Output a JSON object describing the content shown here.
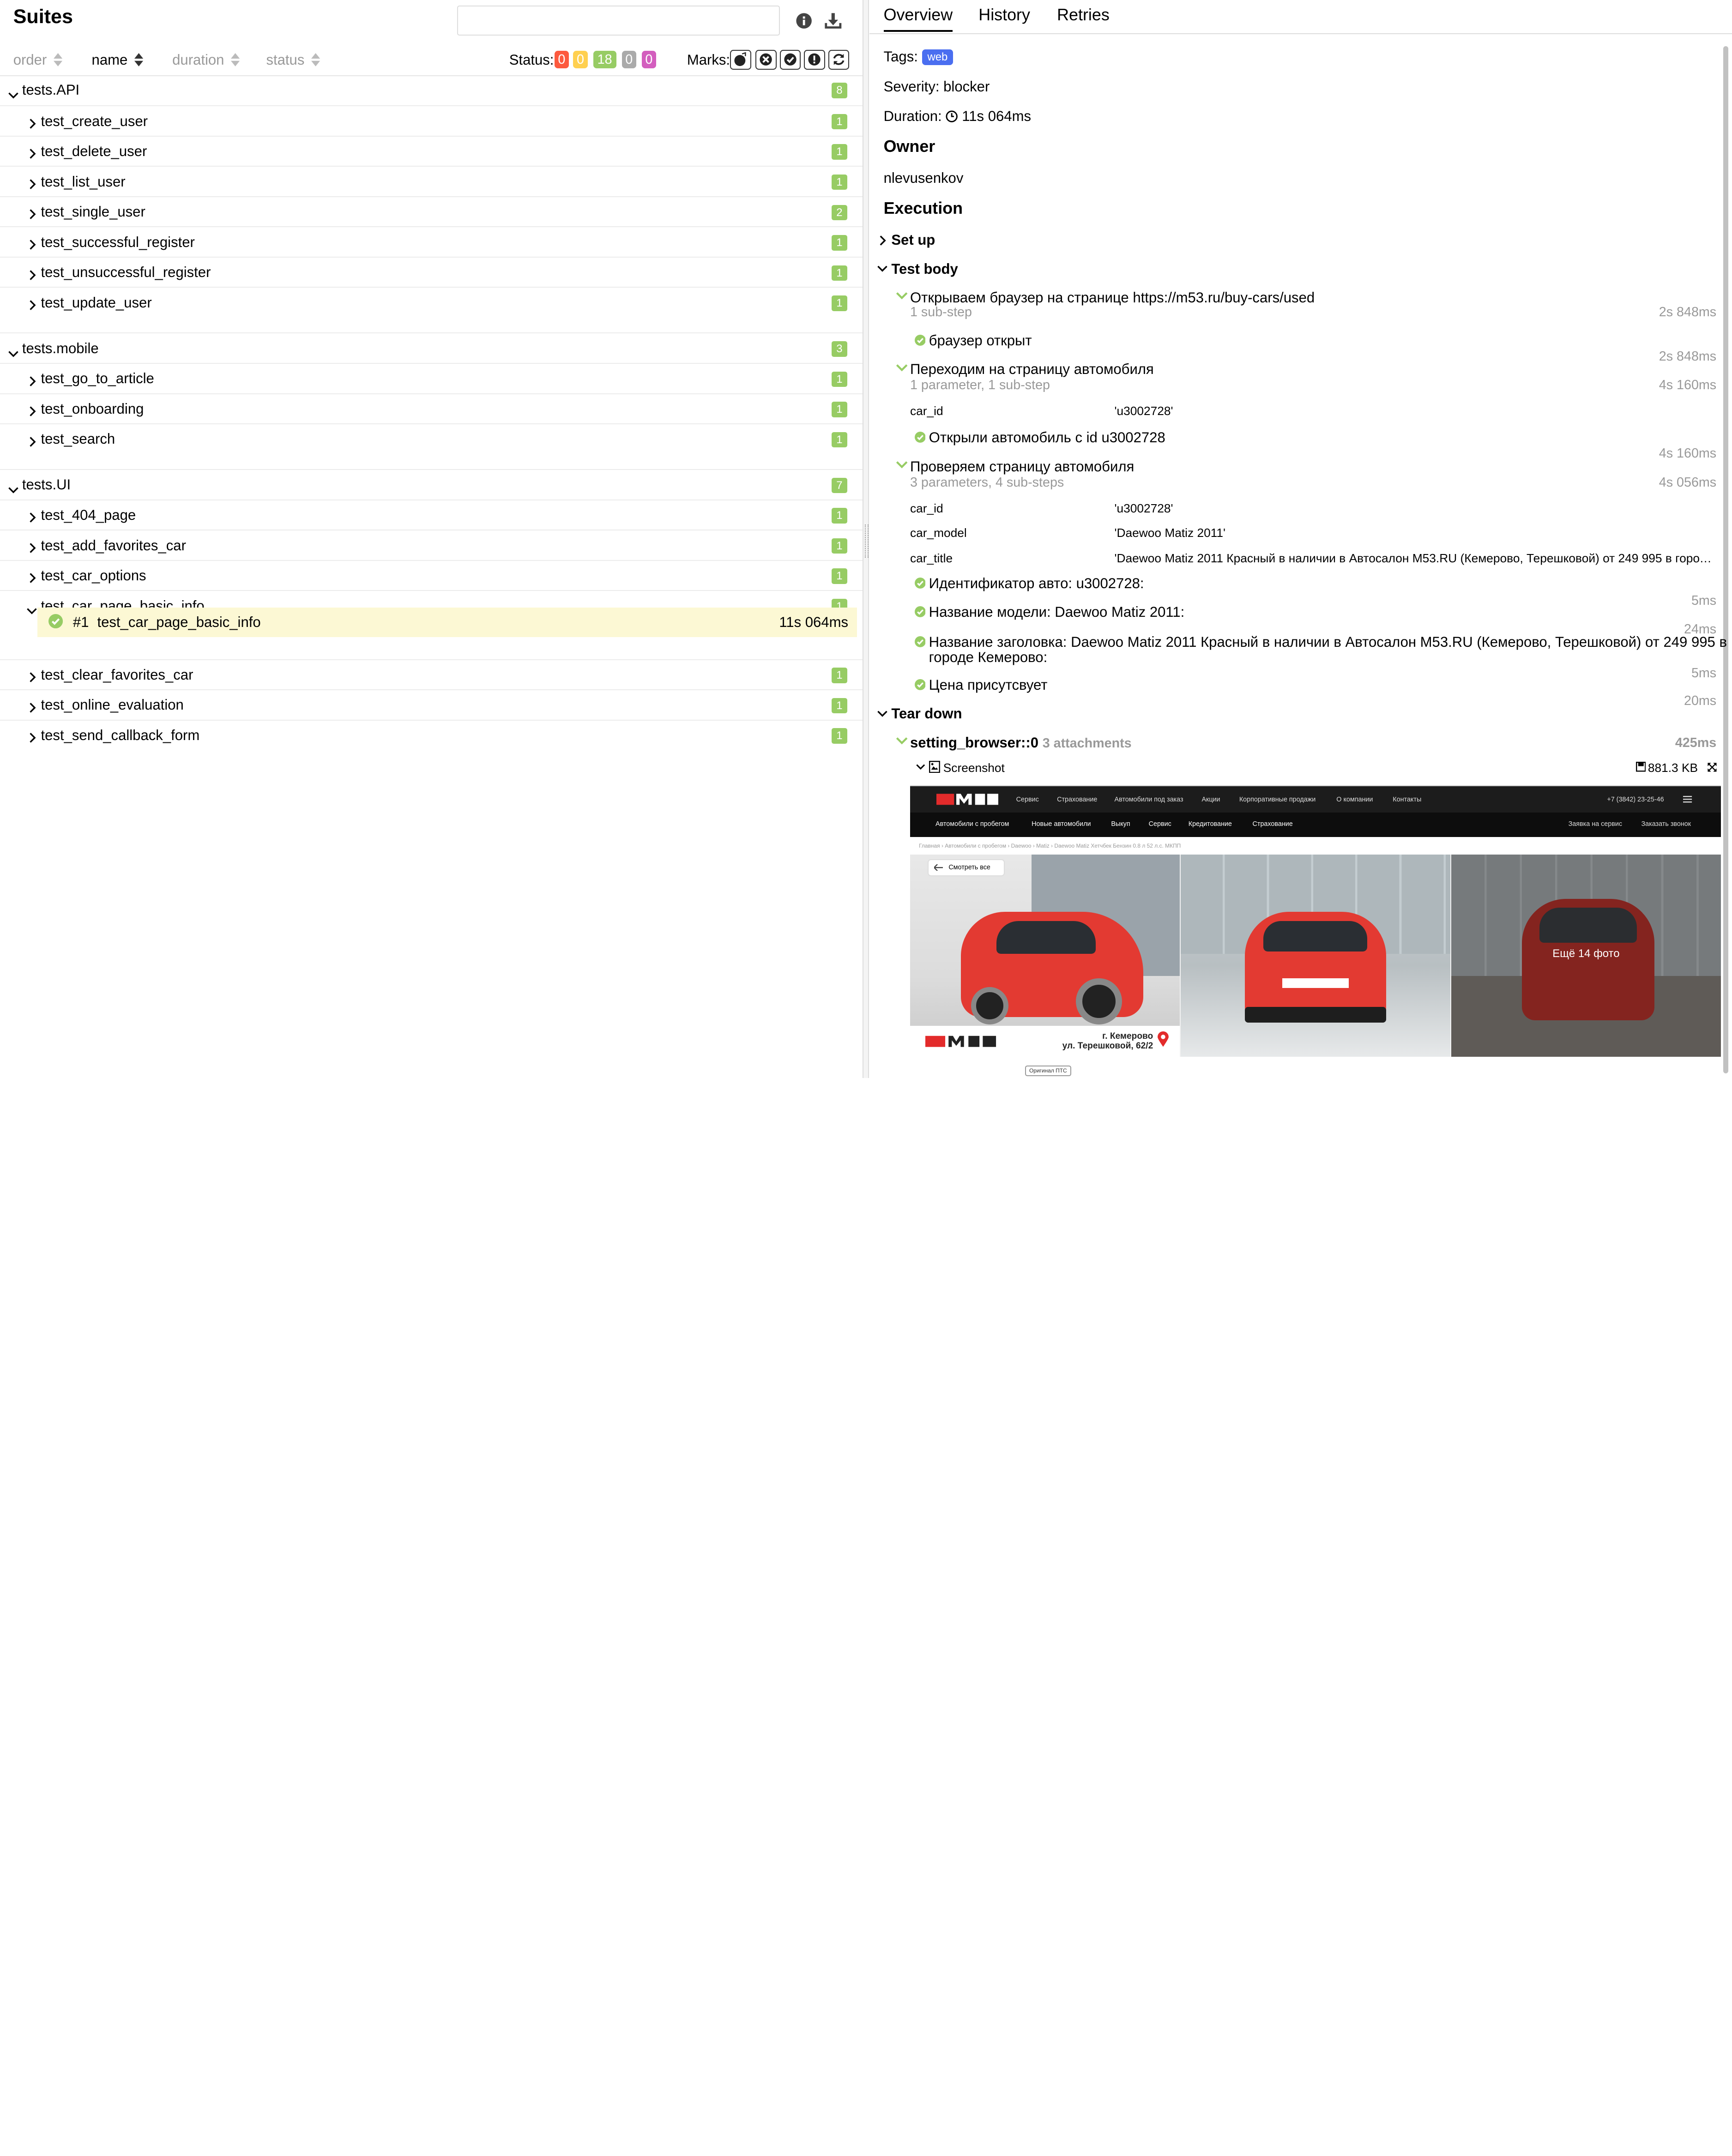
{
  "left": {
    "title": "Suites",
    "search_value": "",
    "sort": {
      "order": "order",
      "name": "name",
      "duration": "duration",
      "status": "status"
    },
    "status_label": "Status:",
    "status_counts": [
      {
        "value": "0",
        "color": "#fd5a3e"
      },
      {
        "value": "0",
        "color": "#ffd050"
      },
      {
        "value": "18",
        "color": "#97cc64"
      },
      {
        "value": "0",
        "color": "#aaaaaa"
      },
      {
        "value": "0",
        "color": "#d35ebe"
      }
    ],
    "marks_label": "Marks:",
    "groups": [
      {
        "name": "tests.API",
        "count": "8",
        "items": [
          {
            "name": "test_create_user",
            "count": "1"
          },
          {
            "name": "test_delete_user",
            "count": "1"
          },
          {
            "name": "test_list_user",
            "count": "1"
          },
          {
            "name": "test_single_user",
            "count": "2"
          },
          {
            "name": "test_successful_register",
            "count": "1"
          },
          {
            "name": "test_unsuccessful_register",
            "count": "1"
          },
          {
            "name": "test_update_user",
            "count": "1"
          }
        ]
      },
      {
        "name": "tests.mobile",
        "count": "3",
        "items": [
          {
            "name": "test_go_to_article",
            "count": "1"
          },
          {
            "name": "test_onboarding",
            "count": "1"
          },
          {
            "name": "test_search",
            "count": "1"
          }
        ]
      },
      {
        "name": "tests.UI",
        "count": "7",
        "items": [
          {
            "name": "test_404_page",
            "count": "1"
          },
          {
            "name": "test_add_favorites_car",
            "count": "1"
          },
          {
            "name": "test_car_options",
            "count": "1"
          },
          {
            "name": "test_car_page_basic_info",
            "count": "1"
          },
          {
            "name": "test_clear_favorites_car",
            "count": "1"
          },
          {
            "name": "test_online_evaluation",
            "count": "1"
          },
          {
            "name": "test_send_callback_form",
            "count": "1"
          }
        ]
      }
    ],
    "selected": {
      "num": "#1",
      "name": "test_car_page_basic_info",
      "duration": "11s 064ms"
    }
  },
  "right": {
    "tabs": [
      "Overview",
      "History",
      "Retries"
    ],
    "tags_label": "Tags:",
    "tag": "web",
    "severity": "Severity: blocker",
    "duration_label": "Duration:",
    "duration_value": "11s 064ms",
    "owner_heading": "Owner",
    "owner": "nlevusenkov",
    "execution_heading": "Execution",
    "setup": "Set up",
    "test_body": "Test body",
    "steps": [
      {
        "title": "Открываем браузер на странице https://m53.ru/buy-cars/used",
        "meta": "1 sub-step",
        "duration": "2s 848ms"
      },
      {
        "title": "Переходим на страницу автомобиля",
        "meta": "1 parameter, 1 sub-step",
        "duration": "4s 160ms"
      },
      {
        "title": "Проверяем страницу автомобиля",
        "meta": "3 parameters, 4 sub-steps",
        "duration": "4s 056ms"
      }
    ],
    "sub1": {
      "text": "браузер открыт",
      "duration": "2s 848ms"
    },
    "sub2": {
      "param_k": "car_id",
      "param_v": "'u3002728'",
      "text": "Открыли автомобиль с id u3002728",
      "duration": "4s 160ms"
    },
    "sub3": {
      "params": [
        {
          "k": "car_id",
          "v": "'u3002728'"
        },
        {
          "k": "car_model",
          "v": "'Daewoo Matiz 2011'"
        },
        {
          "k": "car_title",
          "v": "'Daewoo Matiz 2011 Красный в наличии в Автосалон M53.RU (Кемерово, Терешковой) от 249 995 в городе Кемер..."
        }
      ],
      "checks": [
        {
          "text": "Идентификатор авто: u3002728:",
          "duration": "5ms"
        },
        {
          "text": "Название модели: Daewoo Matiz 2011:",
          "duration": "24ms"
        },
        {
          "text": "Название заголовка: Daewoo Matiz 2011 Красный в наличии в Автосалон M53.RU (Кемерово, Терешковой) от 249 995 в",
          "text2": "городе Кемерово:",
          "duration": "5ms"
        },
        {
          "text": "Цена присутсвует",
          "duration": "20ms"
        }
      ]
    },
    "teardown": "Tear down",
    "fixture": {
      "name": "setting_browser::0",
      "meta": "3 attachments",
      "duration": "425ms"
    },
    "attachment": {
      "name": "Screenshot",
      "size": "881.3 KB"
    },
    "screenshot": {
      "nav1": [
        "Сервис",
        "Страхование",
        "Автомобили под заказ",
        "Акции",
        "Корпоративные продажи",
        "О компании",
        "Контакты"
      ],
      "phone": "+7 (3842) 23-25-46",
      "nav2": [
        "Автомобили с пробегом",
        "Новые автомобили",
        "Выкуп",
        "Сервис",
        "Кредитование",
        "Страхование"
      ],
      "nav2_right": [
        "Заявка на сервис",
        "Заказать звонок"
      ],
      "crumbs": "Главная  ›  Автомобили с пробегом  ›  Daewoo  ›  Matiz  ›  Daewoo Matiz Хетчбек Бензин 0.8 л 52 л.с. МКПП",
      "back": "Смотреть все",
      "more_photos": "Ещё 14 фото",
      "city": "г. Кемерово",
      "street": "ул. Терешковой, 62/2",
      "badge": "Оригинал ПТС"
    }
  }
}
